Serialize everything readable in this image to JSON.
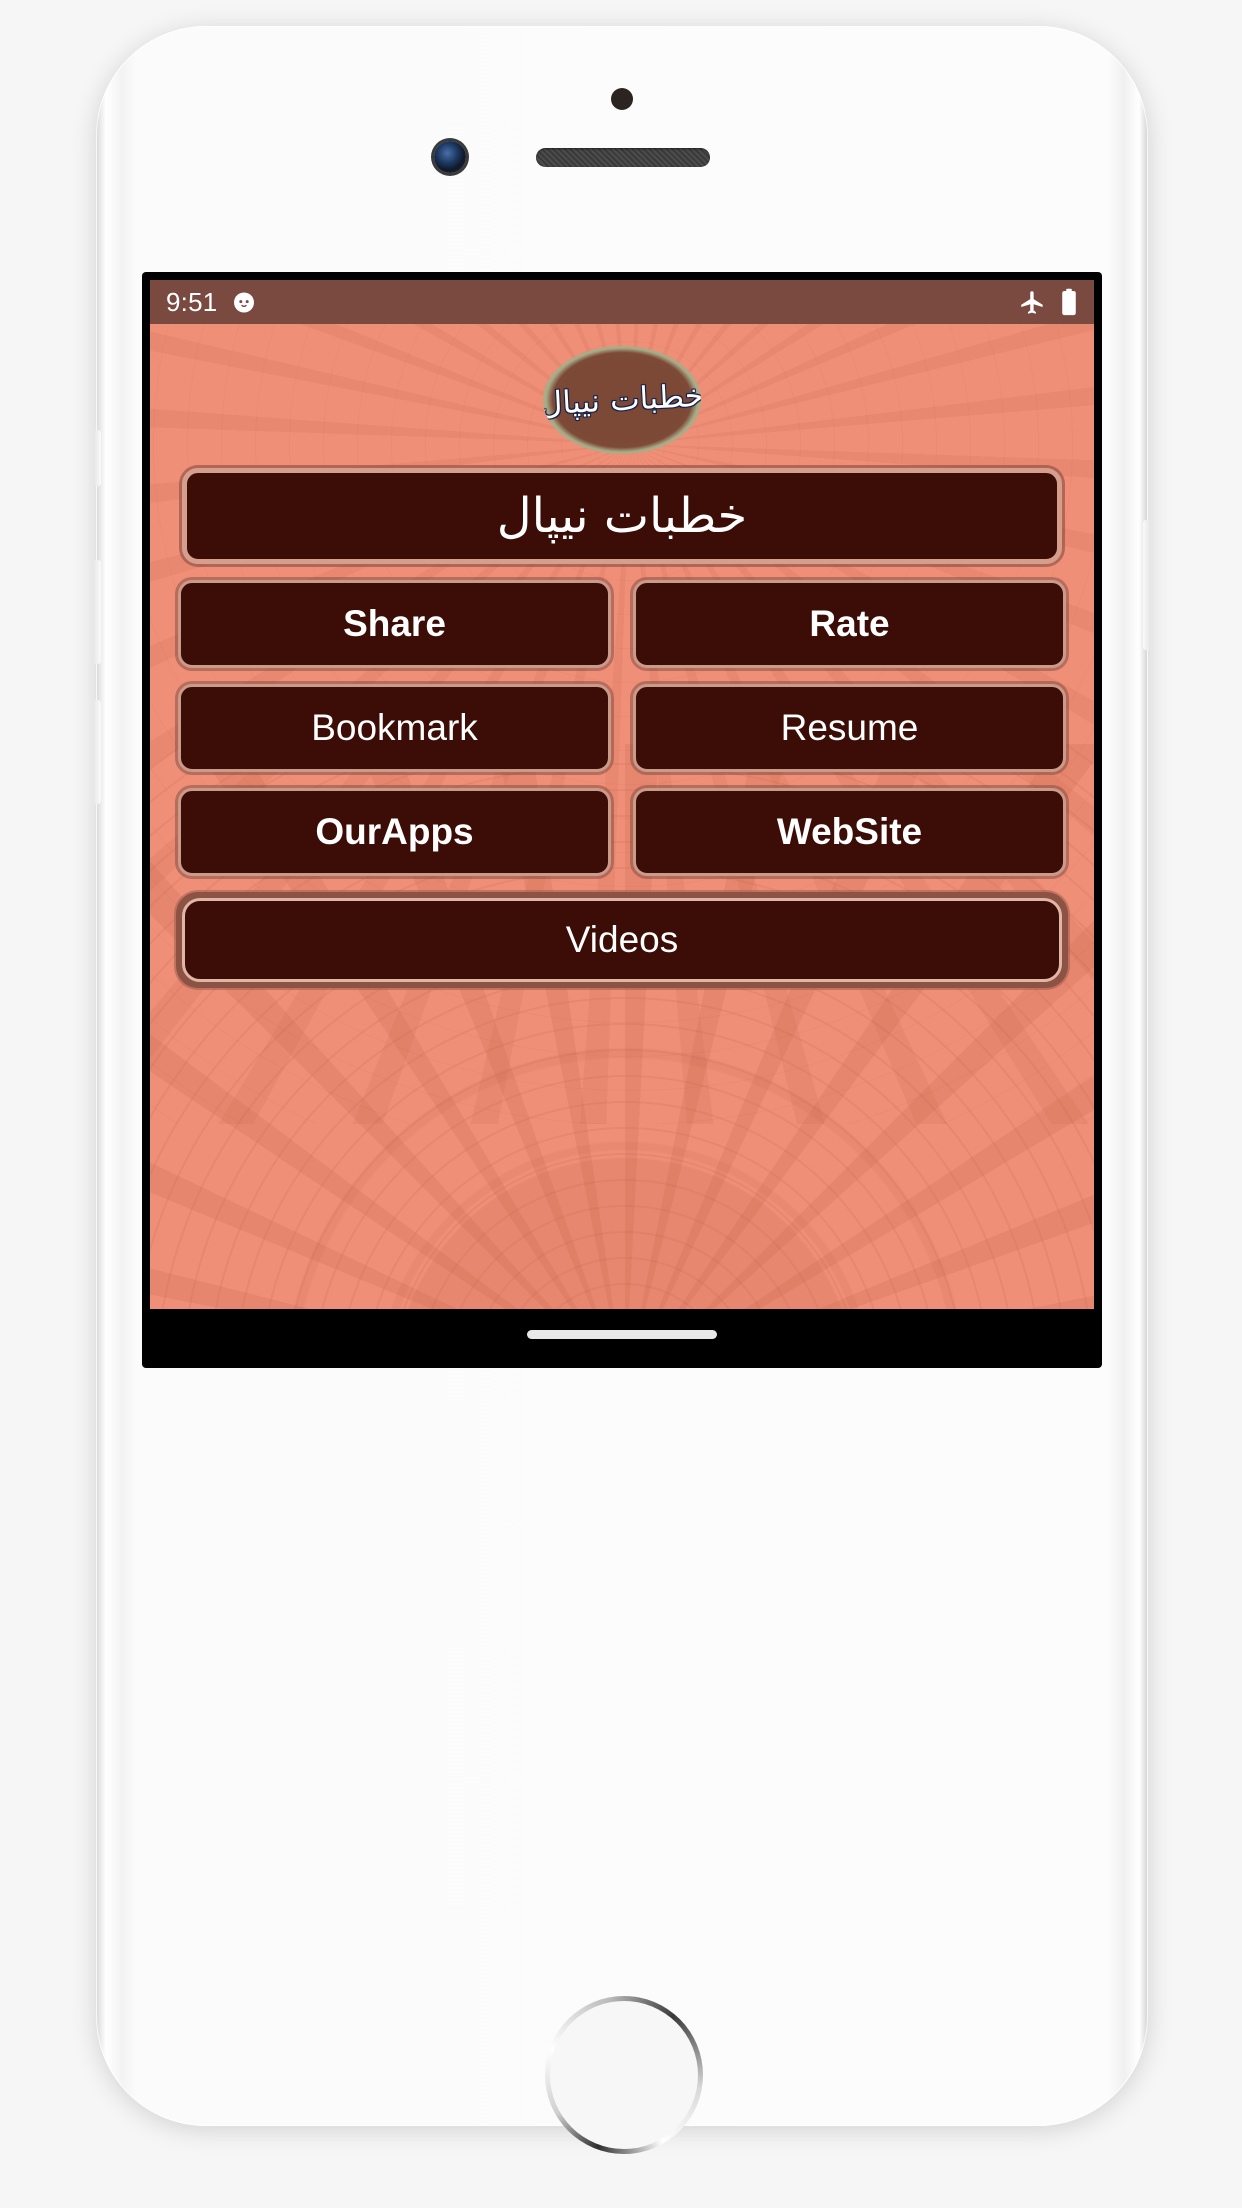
{
  "device": {
    "name": "iphone-mockup",
    "home_button": "home-button",
    "camera": "front-camera-icon",
    "speaker": "earpiece-speaker",
    "sensor": "proximity-sensor-icon"
  },
  "status_bar": {
    "time": "9:51",
    "notification_icon": "cat-face-icon",
    "airplane_icon": "airplane-mode-icon",
    "battery_icon": "battery-full-icon",
    "background_color": "#7a4a41",
    "text_color": "#ffffff"
  },
  "app": {
    "background_color": "#ef8f78",
    "accent_color": "#3b0d06",
    "border_color": "#d69e8c",
    "logo": {
      "text": "خطبات نیپال",
      "name": "app-logo"
    },
    "title": {
      "text": "خطبات نیپال"
    },
    "rows": [
      [
        {
          "label": "Share",
          "name": "share-button",
          "weight": "bold"
        },
        {
          "label": "Rate",
          "name": "rate-button",
          "weight": "bold"
        }
      ],
      [
        {
          "label": "Bookmark",
          "name": "bookmark-button",
          "weight": "reg"
        },
        {
          "label": "Resume",
          "name": "resume-button",
          "weight": "reg"
        }
      ],
      [
        {
          "label": "OurApps",
          "name": "ourapps-button",
          "weight": "bold"
        },
        {
          "label": "WebSite",
          "name": "website-button",
          "weight": "bold"
        }
      ]
    ],
    "videos": {
      "label": "Videos",
      "name": "videos-button"
    }
  },
  "nav_bar": {
    "home_indicator": "home-indicator",
    "background_color": "#000000"
  }
}
